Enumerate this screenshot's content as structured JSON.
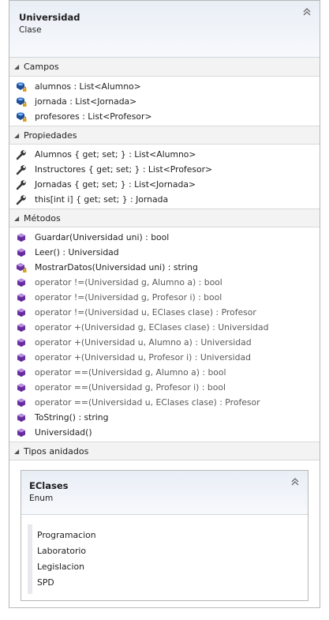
{
  "class_box": {
    "title": "Universidad",
    "subtitle": "Clase",
    "collapse_glyph": "⌃"
  },
  "sections": {
    "fields": {
      "label": "Campos",
      "items": [
        {
          "text": "alumnos : List<Alumno>",
          "icon": "private-field-icon"
        },
        {
          "text": "jornada : List<Jornada>",
          "icon": "private-field-icon"
        },
        {
          "text": "profesores : List<Profesor>",
          "icon": "private-field-icon"
        }
      ]
    },
    "properties": {
      "label": "Propiedades",
      "items": [
        {
          "text": "Alumnos { get; set; } : List<Alumno>",
          "icon": "property-wrench-icon"
        },
        {
          "text": "Instructores { get; set; } : List<Profesor>",
          "icon": "property-wrench-icon"
        },
        {
          "text": "Jornadas { get; set; } : List<Jornada>",
          "icon": "property-wrench-icon"
        },
        {
          "text": "this[int i] { get; set; } : Jornada",
          "icon": "property-wrench-icon"
        }
      ]
    },
    "methods": {
      "label": "Métodos",
      "items": [
        {
          "text": "Guardar(Universidad uni) : bool",
          "icon": "method-icon",
          "dim": false
        },
        {
          "text": "Leer() : Universidad",
          "icon": "method-icon",
          "dim": false
        },
        {
          "text": "MostrarDatos(Universidad uni) : string",
          "icon": "private-method-icon",
          "dim": false
        },
        {
          "text": "operator !=(Universidad g, Alumno a) : bool",
          "icon": "method-icon",
          "dim": true
        },
        {
          "text": "operator !=(Universidad g, Profesor i) : bool",
          "icon": "method-icon",
          "dim": true
        },
        {
          "text": "operator !=(Universidad u, EClases clase) : Profesor",
          "icon": "method-icon",
          "dim": true
        },
        {
          "text": "operator +(Universidad g, EClases clase) : Universidad",
          "icon": "method-icon",
          "dim": true
        },
        {
          "text": "operator +(Universidad u, Alumno a) : Universidad",
          "icon": "method-icon",
          "dim": true
        },
        {
          "text": "operator +(Universidad u, Profesor i) : Universidad",
          "icon": "method-icon",
          "dim": true
        },
        {
          "text": "operator ==(Universidad g, Alumno a) : bool",
          "icon": "method-icon",
          "dim": true
        },
        {
          "text": "operator ==(Universidad g, Profesor i) : bool",
          "icon": "method-icon",
          "dim": true
        },
        {
          "text": "operator ==(Universidad u, EClases clase) : Profesor",
          "icon": "method-icon",
          "dim": true
        },
        {
          "text": "ToString() : string",
          "icon": "method-icon",
          "dim": false
        },
        {
          "text": "Universidad()",
          "icon": "method-icon",
          "dim": false
        }
      ]
    },
    "nested_types": {
      "label": "Tipos anidados"
    }
  },
  "nested_enum": {
    "title": "EClases",
    "subtitle": "Enum",
    "collapse_glyph": "⌃",
    "values": [
      "Programacion",
      "Laboratorio",
      "Legislacion",
      "SPD"
    ]
  },
  "colors": {
    "header_gradient_top": "#e9eef6",
    "field_icon": "#2b6cc4",
    "method_icon": "#6b2fa3",
    "property_icon": "#3c3c3c"
  }
}
